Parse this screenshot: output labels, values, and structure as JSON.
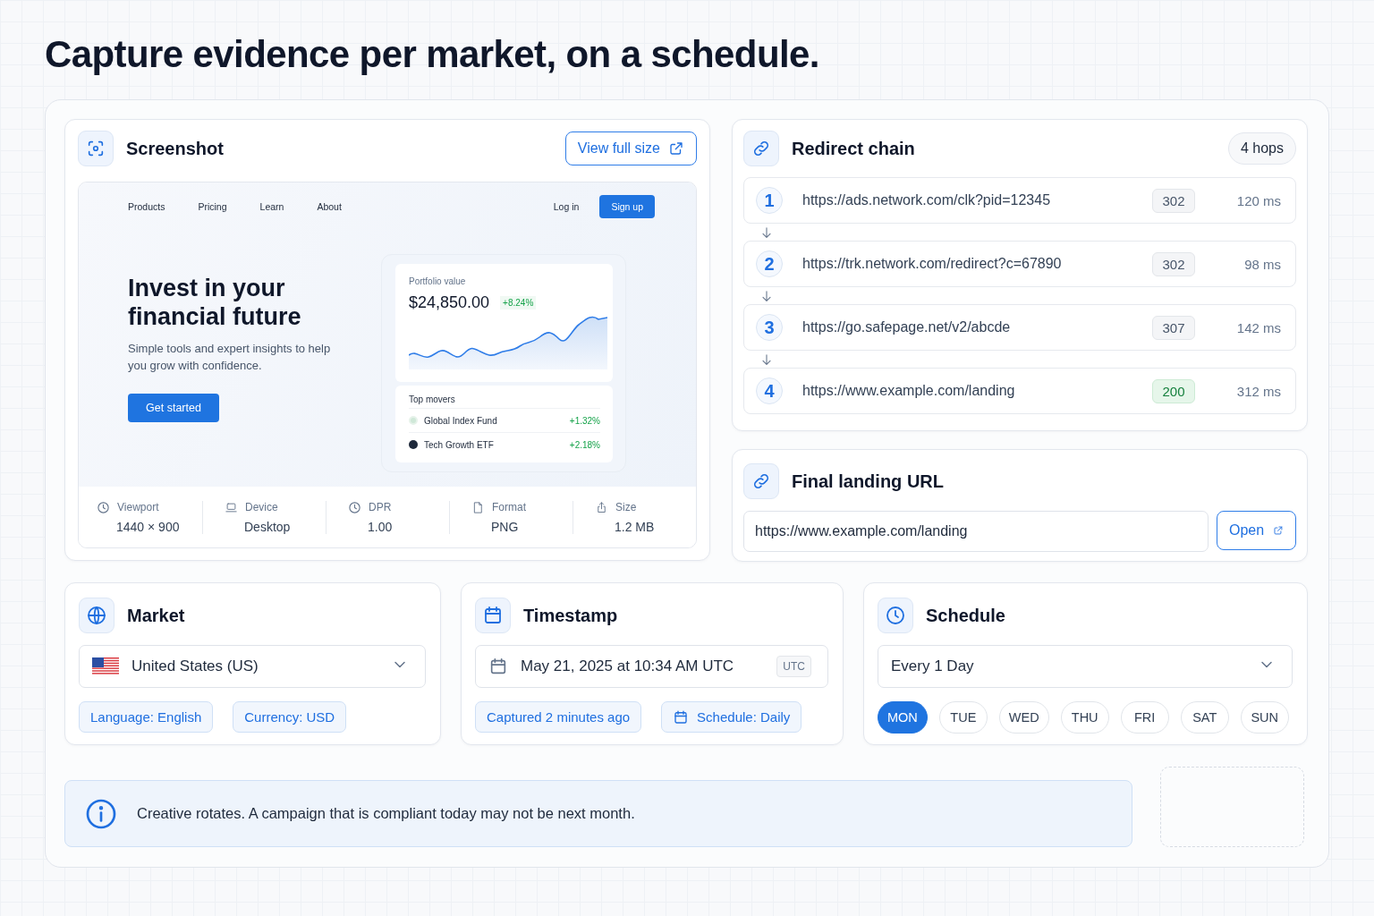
{
  "heading": "Capture evidence per market, on a schedule.",
  "screenshot": {
    "title": "Screenshot",
    "button": "View full size",
    "preview": {
      "nav": [
        "Products",
        "Pricing",
        "Learn",
        "About"
      ],
      "login": "Log in",
      "signup": "Sign up",
      "hero_title": "Invest in your financial future",
      "hero_text": "Simple tools and expert insights to help you grow with confidence.",
      "cta": "Get started",
      "portfolio": {
        "label": "Portfolio value",
        "value": "$24,850.00",
        "change": "+8.24%"
      },
      "movers": {
        "title": "Top movers",
        "items": [
          {
            "name": "Global Index Fund",
            "change": "+1.32%",
            "kind": "globe"
          },
          {
            "name": "Tech Growth ETF",
            "change": "+2.18%",
            "kind": "dark"
          }
        ]
      }
    },
    "meta": [
      {
        "kind": "viewport",
        "label": "Viewport",
        "value": "1440 × 900"
      },
      {
        "kind": "device",
        "label": "Device",
        "value": "Desktop"
      },
      {
        "kind": "dpr",
        "label": "DPR",
        "value": "1.00"
      },
      {
        "kind": "format",
        "label": "Format",
        "value": "PNG"
      },
      {
        "kind": "size",
        "label": "Size",
        "value": "1.2 MB"
      }
    ]
  },
  "redirect_chain": {
    "title": "Redirect chain",
    "count": "4 hops",
    "hops": [
      {
        "step": "1",
        "url": "https://ads.network.com/clk?pid=12345",
        "status": "302",
        "time": "120 ms",
        "kind": "redirect"
      },
      {
        "step": "2",
        "url": "https://trk.network.com/redirect?c=67890",
        "status": "302",
        "time": "98 ms",
        "kind": "redirect"
      },
      {
        "step": "3",
        "url": "https://go.safepage.net/v2/abcde",
        "status": "307",
        "time": "142 ms",
        "kind": "redirect"
      },
      {
        "step": "4",
        "url": "https://www.example.com/landing",
        "status": "200",
        "time": "312 ms",
        "kind": "success"
      }
    ]
  },
  "final_url": {
    "title": "Final landing URL",
    "value": "https://www.example.com/landing",
    "button": "Open"
  },
  "market": {
    "title": "Market",
    "select": "United States (US)",
    "tags": [
      "Language: English",
      "Currency: USD"
    ]
  },
  "timestamp": {
    "title": "Timestamp",
    "value": "May 21, 2025 at 10:34 AM UTC",
    "zone": "UTC",
    "tags": [
      {
        "text": "Captured 2 minutes ago",
        "kind": "plain"
      },
      {
        "text": "Schedule: Daily",
        "kind": "calendar"
      }
    ]
  },
  "schedule": {
    "title": "Schedule",
    "select": "Every 1 Day",
    "days": [
      {
        "label": "MON",
        "selected": true
      },
      {
        "label": "TUE",
        "selected": false
      },
      {
        "label": "WED",
        "selected": false
      },
      {
        "label": "THU",
        "selected": false
      },
      {
        "label": "FRI",
        "selected": false
      },
      {
        "label": "SAT",
        "selected": false
      },
      {
        "label": "SUN",
        "selected": false
      }
    ]
  },
  "notice": {
    "text": "Creative rotates. A campaign that is compliant today may not be next month."
  }
}
